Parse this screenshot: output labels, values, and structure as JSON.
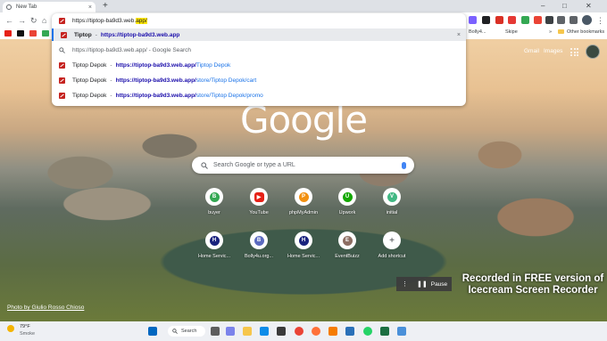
{
  "browser": {
    "tab": {
      "title": "New Tab",
      "close": "×"
    },
    "new_tab": "+",
    "window_controls": {
      "minimize": "–",
      "maximize": "□",
      "close": "✕"
    },
    "nav": {
      "back": "←",
      "forward": "→",
      "reload": "↻",
      "home": "⌂"
    },
    "omnibox": {
      "typed_prefix": "https://tiptop-ba9d3.web.",
      "typed_highlight": "app/",
      "suggestions": [
        {
          "title": "Tiptop",
          "sep": "-",
          "url_bold": "https://tiptop-ba9d3.web.app",
          "url_rest": "",
          "remove": "×"
        },
        {
          "text": "https://tiptop-ba9d3.web.app/ - Google Search"
        },
        {
          "title": "Tiptop Depok",
          "sep": "-",
          "url_bold": "https://tiptop-ba9d3.web.app/",
          "url_rest": "Tiptop Depok"
        },
        {
          "title": "Tiptop Depok",
          "sep": "-",
          "url_bold": "https://tiptop-ba9d3.web.app/",
          "url_rest": "store/Tiptop Depok/cart"
        },
        {
          "title": "Tiptop Depok",
          "sep": "-",
          "url_bold": "https://tiptop-ba9d3.web.app/",
          "url_rest": "store/Tiptop Depok/promo"
        }
      ]
    },
    "bookmarks": {
      "bollyx": "Bolly4...",
      "skipe": "Skipe",
      "other": "Other bookmarks",
      "more": "»"
    }
  },
  "ntp": {
    "gmail": "Gmail",
    "images": "Images",
    "logo": "Google",
    "search_placeholder": "Search Google or type a URL",
    "shortcuts": [
      {
        "label": "buyer",
        "glyph": "B"
      },
      {
        "label": "YouTube",
        "glyph": "▶"
      },
      {
        "label": "phpMyAdmin",
        "glyph": "P"
      },
      {
        "label": "Upwork",
        "glyph": "U"
      },
      {
        "label": "initial",
        "glyph": "V"
      },
      {
        "label": "Home Servic...",
        "glyph": "H"
      },
      {
        "label": "Bolly4u.org...",
        "glyph": "B"
      },
      {
        "label": "Home Servic...",
        "glyph": "H"
      },
      {
        "label": "EventBuizz",
        "glyph": "E"
      },
      {
        "label": "Add shortcut",
        "glyph": "+"
      }
    ],
    "photo_credit": "Photo by Giulio Rosso Chioso"
  },
  "recorder": {
    "pause": "Pause",
    "watermark": "Recorded in FREE version of Icecream Screen Recorder"
  },
  "taskbar": {
    "temp": "79°F",
    "condition": "Smoke",
    "search": "Search"
  },
  "colors": {
    "accent": "#1a73e8",
    "highlight": "#ffe600",
    "favicon_red": "#c5221f"
  }
}
